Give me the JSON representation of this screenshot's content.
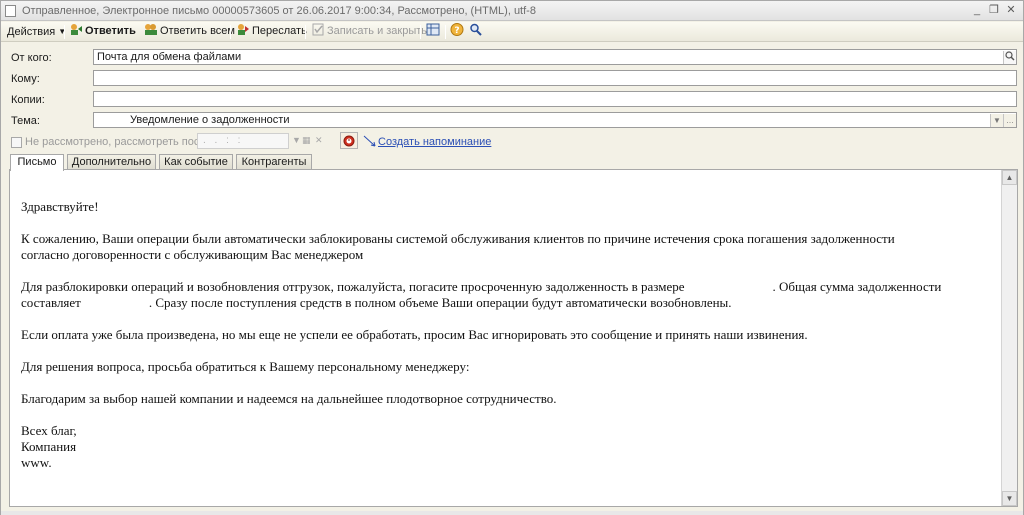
{
  "window": {
    "title": "Отправленное, Электронное письмо 00000573605 от 26.06.2017 9:00:34, Рассмотрено, (HTML), utf-8",
    "controls": {
      "minimize": "_",
      "restore": "❐",
      "close": "✕"
    }
  },
  "toolbar": {
    "actions": "Действия",
    "reply": "Ответить",
    "reply_all": "Ответить всем",
    "forward": "Переслать",
    "save_close": "Записать и закрыть"
  },
  "fields": {
    "from_label": "От кого:",
    "from_value": "Почта для обмена файлами",
    "to_label": "Кому:",
    "to_value": "",
    "cc_label": "Копии:",
    "cc_value": "",
    "subject_label": "Тема:",
    "subject_value": "Уведомление о задолженности"
  },
  "reminder": {
    "checkbox_label": "Не рассмотрено, рассмотреть после:",
    "date_placeholder": ". .   :  :",
    "link": "Создать напоминание"
  },
  "tabs": [
    {
      "label": "Письмо",
      "active": true
    },
    {
      "label": "Дополнительно",
      "active": false
    },
    {
      "label": "Как событие",
      "active": false
    },
    {
      "label": "Контрагенты",
      "active": false
    }
  ],
  "body": {
    "greeting": "Здравствуйте!",
    "p1_line1": "К сожалению, Ваши операции были автоматически заблокированы системой обслуживания клиентов по причине истечения срока погашения задолженности",
    "p1_line2": "согласно договоренности с обслуживающим Вас менеджером",
    "p2_line1a": "Для разблокировки операций и возобновления отгрузок, пожалуйста, погасите просроченную задолженность в размере",
    "p2_line1b": ". Общая сумма задолженности",
    "p2_line2a": "составляет",
    "p2_line2b": ". Сразу после поступления средств в полном объеме Ваши операции будут автоматически возобновлены.",
    "p3": "Если оплата уже была произведена, но мы еще не успели ее обработать, просим Вас игнорировать это сообщение и принять наши извинения.",
    "p4": "Для решения вопроса, просьба обратиться к Вашему персональному менеджеру:",
    "p5": "Благодарим за выбор нашей компании и надеемся на дальнейшее плодотворное сотрудничество.",
    "sign1": "Всех благ,",
    "sign2": "Компания",
    "sign3": "www."
  },
  "colors": {
    "link": "#2b4fb5",
    "window_bg": "#f3f1e6"
  }
}
